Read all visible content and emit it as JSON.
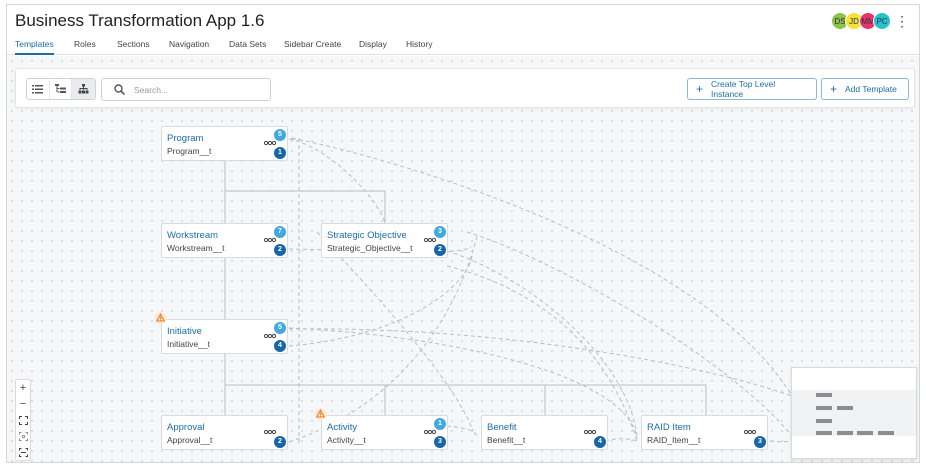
{
  "app": {
    "title": "Business Transformation App 1.6"
  },
  "users": [
    {
      "initials": "DS",
      "color": "#8bc34a"
    },
    {
      "initials": "JD",
      "color": "#f4e23b"
    },
    {
      "initials": "MM",
      "color": "#e8336d"
    },
    {
      "initials": "PC",
      "color": "#26c1cc"
    }
  ],
  "tabs": [
    {
      "label": "Templates",
      "active": true
    },
    {
      "label": "Roles"
    },
    {
      "label": "Sections"
    },
    {
      "label": "Navigation"
    },
    {
      "label": "Data Sets"
    },
    {
      "label": "Sidebar Create"
    },
    {
      "label": "Display"
    },
    {
      "label": "History"
    }
  ],
  "toolbar": {
    "view_modes": [
      "list-icon",
      "tree-icon",
      "hierarchy-icon"
    ],
    "active_view": "hierarchy-icon",
    "search_placeholder": "Search...",
    "search_value": "",
    "create_instance_label": "Create Top Level Instance",
    "add_template_label": "Add Template"
  },
  "colors": {
    "accent": "#1a6fa8",
    "badge_light": "#3fa9e0",
    "badge_dark": "#1766a8",
    "warning": "#e67e22"
  },
  "nodes": [
    {
      "id": "program",
      "name": "Program",
      "api": "Program__t",
      "children_count": "5",
      "links_count": "1",
      "warning": false
    },
    {
      "id": "workstream",
      "name": "Workstream",
      "api": "Workstream__t",
      "children_count": "7",
      "links_count": "2",
      "warning": false
    },
    {
      "id": "strategic",
      "name": "Strategic Objective",
      "api": "Strategic_Objective__t",
      "children_count": "3",
      "links_count": "2",
      "warning": false
    },
    {
      "id": "initiative",
      "name": "Initiative",
      "api": "Initiative__t",
      "children_count": "5",
      "links_count": "4",
      "warning": true
    },
    {
      "id": "approval",
      "name": "Approval",
      "api": "Approval__t",
      "children_count": "",
      "links_count": "2",
      "warning": false
    },
    {
      "id": "activity",
      "name": "Activity",
      "api": "Activity__t",
      "children_count": "1",
      "links_count": "3",
      "warning": true
    },
    {
      "id": "benefit",
      "name": "Benefit",
      "api": "Benefit__t",
      "children_count": "",
      "links_count": "4",
      "warning": false
    },
    {
      "id": "raid",
      "name": "RAID Item",
      "api": "RAID_Item__t",
      "children_count": "",
      "links_count": "3",
      "warning": false
    }
  ],
  "zoom_controls": [
    "zoom-in-icon",
    "zoom-out-icon",
    "fit-view-icon",
    "focus-icon",
    "expand-icon"
  ]
}
